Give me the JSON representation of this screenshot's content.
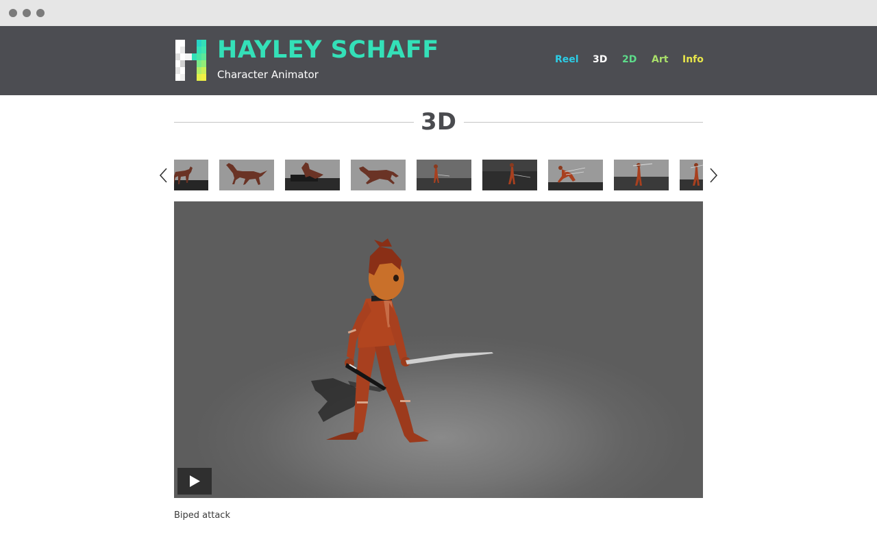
{
  "site": {
    "title": "HAYLEY SCHAFF",
    "subtitle": "Character Animator"
  },
  "nav": [
    {
      "label": "Reel",
      "color": "#2ccde6"
    },
    {
      "label": "3D",
      "color": "#ffffff"
    },
    {
      "label": "2D",
      "color": "#5ddc8a"
    },
    {
      "label": "Art",
      "color": "#a9e06a"
    },
    {
      "label": "Info",
      "color": "#e8e64a"
    }
  ],
  "section": {
    "title": "3D"
  },
  "carousel": {
    "prev_icon": "chevron-left-icon",
    "next_icon": "chevron-right-icon",
    "thumbnails": [
      {
        "subject": "horse"
      },
      {
        "subject": "horse"
      },
      {
        "subject": "horse-jump"
      },
      {
        "subject": "horse"
      },
      {
        "subject": "biped-attack",
        "selected": true
      },
      {
        "subject": "biped"
      },
      {
        "subject": "biped-lunge"
      },
      {
        "subject": "biped-spear"
      },
      {
        "subject": "biped"
      }
    ]
  },
  "viewer": {
    "play_icon": "play-icon",
    "caption": "Biped attack"
  },
  "colors": {
    "header_bg": "#4c4d52",
    "accent": "#34e0b8",
    "heading": "#4a4b4f"
  }
}
